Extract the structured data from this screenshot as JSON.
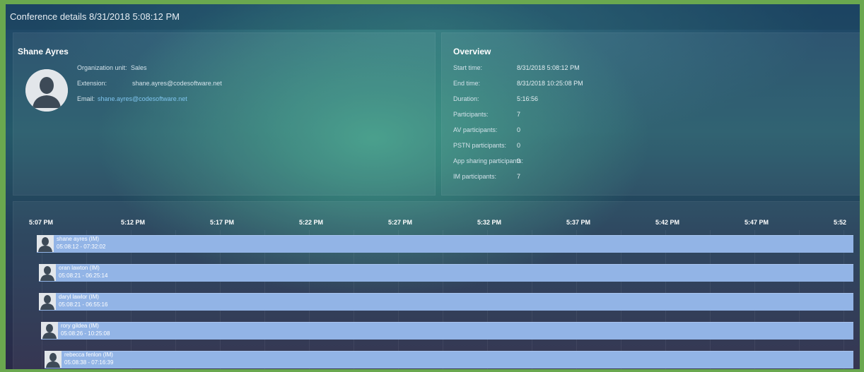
{
  "title": "Conference details 8/31/2018 5:08:12 PM",
  "user": {
    "name": "Shane Ayres",
    "avatar_icon": "person-silhouette-icon",
    "org_unit_label": "Organization unit:",
    "org_unit_value": "Sales",
    "extension_label": "Extension:",
    "extension_value": "shane.ayres@codesoftware.net",
    "email_label": "Email:",
    "email_value": "shane.ayres@codesoftware.net"
  },
  "overview": {
    "title": "Overview",
    "rows": [
      {
        "label": "Start time:",
        "value": "8/31/2018 5:08:12 PM"
      },
      {
        "label": "End time:",
        "value": "8/31/2018 10:25:08 PM"
      },
      {
        "label": "Duration:",
        "value": "5:16:56"
      },
      {
        "label": "Participants:",
        "value": "7"
      },
      {
        "label": "AV participants:",
        "value": "0"
      },
      {
        "label": "PSTN participants:",
        "value": "0"
      },
      {
        "label": "App sharing participants:",
        "value": "0"
      },
      {
        "label": "IM participants:",
        "value": "7"
      }
    ]
  },
  "timeline": {
    "ticks": [
      "5:07 PM",
      "5:12 PM",
      "5:17 PM",
      "5:22 PM",
      "5:27 PM",
      "5:32 PM",
      "5:37 PM",
      "5:42 PM",
      "5:47 PM",
      "5:52"
    ],
    "participants": [
      {
        "name": "shane ayres (IM)",
        "time": "05:08:12 - 07:32:02"
      },
      {
        "name": "oran lawton (IM)",
        "time": "05:08:21 - 06:25:14"
      },
      {
        "name": "daryl lawlor (IM)",
        "time": "05:08:21 - 06:55:16"
      },
      {
        "name": "rory gildea (IM)",
        "time": "05:08:26 - 10:25:08"
      },
      {
        "name": "rebecca fenlon (IM)",
        "time": "05:08:38 - 07:16:39"
      }
    ],
    "bar_color": "#92b4e6"
  },
  "colors": {
    "frame_border": "#6aa84f",
    "link": "#7fc4ee"
  }
}
